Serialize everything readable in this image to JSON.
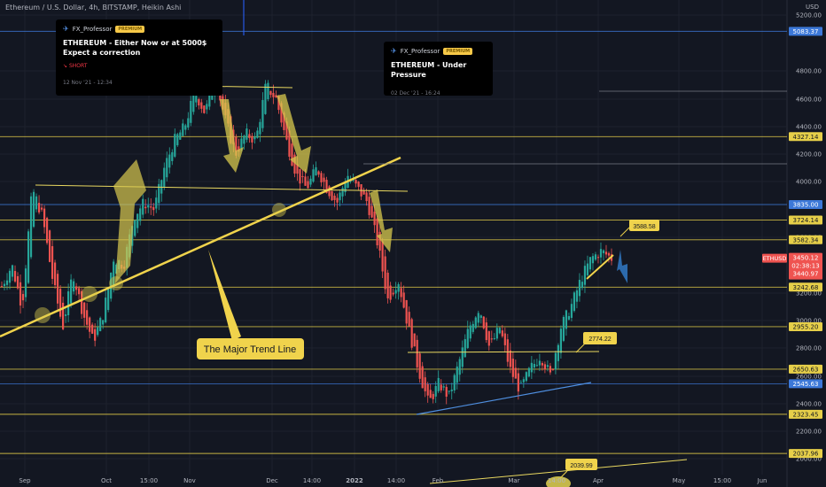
{
  "header": {
    "title": "Ethereum / U.S. Dollar, 4h, BITSTAMP, Heikin Ashi",
    "currency": "USD"
  },
  "ideas": [
    {
      "author": "FX_Professor",
      "badge": "PREMIUM",
      "title": "ETHEREUM - Either Now or at 5000$ Expect a correction",
      "direction": "SHORT",
      "date": "12 Nov '21 - 12:34"
    },
    {
      "author": "FX_Professor",
      "badge": "PREMIUM",
      "title": "ETHEREUM - Under Pressure",
      "date": "02 Dec '21 - 16:24"
    }
  ],
  "chart_data": {
    "type": "candlestick",
    "symbol": "ETHUSD",
    "x_ticks": [
      "Sep",
      "Oct",
      "15:00",
      "Nov",
      "Dec",
      "14:00",
      "2022",
      "14:00",
      "Feb",
      "Mar",
      "14:00",
      "Apr",
      "May",
      "15:00",
      "Jun"
    ],
    "y_ticks": [
      5200,
      4800,
      4600,
      4400,
      4200,
      4000,
      3600,
      3200,
      3000,
      2800,
      2600,
      2400,
      2200,
      2000
    ],
    "ylim": [
      1950,
      5250
    ],
    "horizontal_levels": [
      5083.37,
      4327.14,
      3835.0,
      3724.14,
      3582.34,
      3242.68,
      2955.2,
      2650.63,
      2545.63,
      2323.45,
      2037.96
    ],
    "price_path": [
      3250,
      3400,
      3100,
      3950,
      3750,
      3300,
      2950,
      3350,
      3050,
      2850,
      3050,
      3450,
      3400,
      3750,
      3850,
      3800,
      4100,
      4300,
      4400,
      4650,
      4500,
      4750,
      4450,
      4200,
      4350,
      4300,
      4700,
      4600,
      4300,
      4050,
      3950,
      4100,
      3950,
      3850,
      4050,
      3950,
      3850,
      3550,
      3150,
      3300,
      2950,
      2650,
      2400,
      2550,
      2450,
      2700,
      2950,
      3100,
      2800,
      2950,
      2650,
      2500,
      2650,
      2750,
      2600,
      2950,
      3100,
      3300,
      3450,
      3500,
      3450
    ],
    "current_price": {
      "label": "ETHUSD",
      "value": "3450.12",
      "countdown": "02:38:13",
      "low": "3440.97"
    },
    "annotations": {
      "trend_line_label": "The Major Trend Line",
      "price_labels": [
        "3588.58",
        "2774.22",
        "2039.99"
      ]
    }
  }
}
